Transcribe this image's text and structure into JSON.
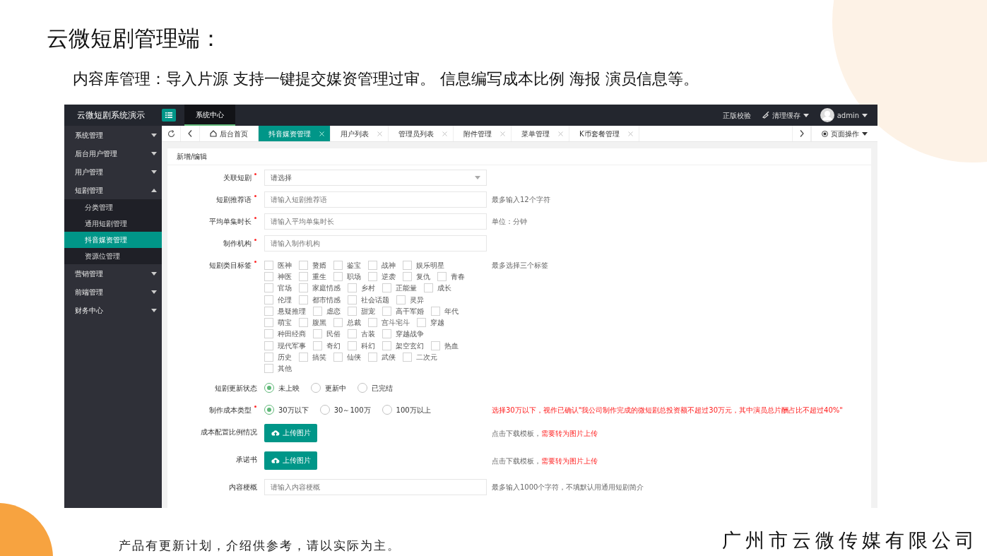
{
  "slide": {
    "title": "云微短剧管理端：",
    "subtitle": "内容库管理：导入片源 支持一键提交媒资管理过审。 信息编写成本比例 海报 演员信息等。",
    "footer_note": "产品有更新计划，介绍供参考，请以实际为主。",
    "company": "广州市云微传媒有限公司"
  },
  "app": {
    "brand": "云微短剧系统演示",
    "top_tabs": [
      {
        "label": "系统中心",
        "selected": true
      }
    ],
    "verify": "正版校验",
    "clear_cache": "清理缓存",
    "user": "admin"
  },
  "sidebar": [
    {
      "label": "系统管理",
      "expanded": false
    },
    {
      "label": "后台用户管理",
      "expanded": false
    },
    {
      "label": "用户管理",
      "expanded": false
    },
    {
      "label": "短剧管理",
      "expanded": true,
      "children": [
        {
          "label": "分类管理",
          "selected": false
        },
        {
          "label": "通用短剧管理",
          "selected": false
        },
        {
          "label": "抖音媒资管理",
          "selected": true
        },
        {
          "label": "资源位管理",
          "selected": false
        }
      ]
    },
    {
      "label": "营销管理",
      "expanded": false
    },
    {
      "label": "前端管理",
      "expanded": false
    },
    {
      "label": "财务中心",
      "expanded": false
    }
  ],
  "tabs": [
    {
      "kind": "home",
      "label": "后台首页",
      "selected": false
    },
    {
      "kind": "page",
      "label": "抖音媒资管理",
      "selected": true
    },
    {
      "kind": "page",
      "label": "用户列表",
      "selected": false
    },
    {
      "kind": "page",
      "label": "管理员列表",
      "selected": false
    },
    {
      "kind": "page",
      "label": "附件管理",
      "selected": false
    },
    {
      "kind": "page",
      "label": "菜单管理",
      "selected": false
    },
    {
      "kind": "page",
      "label": "K币套餐管理",
      "selected": false
    }
  ],
  "page_ops": "页面操作",
  "panel_title": "新增/编辑",
  "form": [
    {
      "kind": "select",
      "label": "关联短剧",
      "required": true,
      "placeholder": "请选择"
    },
    {
      "kind": "input",
      "label": "短剧推荐语",
      "required": true,
      "placeholder": "请输入短剧推荐语",
      "hint": "最多输入12个字符"
    },
    {
      "kind": "input",
      "label": "平均单集时长",
      "required": true,
      "placeholder": "请输入平均单集时长",
      "hint": "单位：分钟"
    },
    {
      "kind": "input",
      "label": "制作机构",
      "required": true,
      "placeholder": "请输入制作机构"
    },
    {
      "kind": "tags",
      "label": "短剧类目标签",
      "required": true,
      "hint": "最多选择三个标签",
      "rows": [
        [
          {
            "label": "医神",
            "checked": false
          },
          {
            "label": "赘婿",
            "checked": false
          },
          {
            "label": "鉴宝",
            "checked": false
          },
          {
            "label": "战神",
            "checked": false
          },
          {
            "label": "娱乐明星",
            "checked": false
          }
        ],
        [
          {
            "label": "神医",
            "checked": false
          },
          {
            "label": "重生",
            "checked": false
          },
          {
            "label": "职场",
            "checked": false
          },
          {
            "label": "逆袭",
            "checked": false
          },
          {
            "label": "复仇",
            "checked": false
          },
          {
            "label": "青春",
            "checked": false
          }
        ],
        [
          {
            "label": "官场",
            "checked": false
          },
          {
            "label": "家庭情感",
            "checked": false
          },
          {
            "label": "乡村",
            "checked": false
          },
          {
            "label": "正能量",
            "checked": false
          },
          {
            "label": "成长",
            "checked": false
          }
        ],
        [
          {
            "label": "伦理",
            "checked": false
          },
          {
            "label": "都市情感",
            "checked": false
          },
          {
            "label": "社会话题",
            "checked": false
          },
          {
            "label": "灵异",
            "checked": false
          }
        ],
        [
          {
            "label": "悬疑推理",
            "checked": false
          },
          {
            "label": "虐恋",
            "checked": false
          },
          {
            "label": "甜宠",
            "checked": false
          },
          {
            "label": "高干军婚",
            "checked": false
          },
          {
            "label": "年代",
            "checked": false
          }
        ],
        [
          {
            "label": "萌宝",
            "checked": false
          },
          {
            "label": "腹黑",
            "checked": false
          },
          {
            "label": "总裁",
            "checked": false
          },
          {
            "label": "宫斗宅斗",
            "checked": false
          },
          {
            "label": "穿越",
            "checked": false
          }
        ],
        [
          {
            "label": "种田经商",
            "checked": false
          },
          {
            "label": "民俗",
            "checked": false
          },
          {
            "label": "古装",
            "checked": false
          },
          {
            "label": "穿越战争",
            "checked": false
          }
        ],
        [
          {
            "label": "现代军事",
            "checked": false
          },
          {
            "label": "奇幻",
            "checked": false
          },
          {
            "label": "科幻",
            "checked": false
          },
          {
            "label": "架空玄幻",
            "checked": false
          },
          {
            "label": "热血",
            "checked": false
          }
        ],
        [
          {
            "label": "历史",
            "checked": false
          },
          {
            "label": "搞笑",
            "checked": false
          },
          {
            "label": "仙侠",
            "checked": false
          },
          {
            "label": "武侠",
            "checked": false
          },
          {
            "label": "二次元",
            "checked": false
          }
        ],
        [
          {
            "label": "其他",
            "checked": false
          }
        ]
      ]
    },
    {
      "kind": "radio",
      "label": "短剧更新状态",
      "required": false,
      "options": [
        {
          "label": "未上映",
          "selected": true
        },
        {
          "label": "更新中",
          "selected": false
        },
        {
          "label": "已完结",
          "selected": false
        }
      ]
    },
    {
      "kind": "radio",
      "label": "制作成本类型",
      "required": true,
      "options": [
        {
          "label": "30万以下",
          "selected": true
        },
        {
          "label": "30～100万",
          "selected": false
        },
        {
          "label": "100万以上",
          "selected": false
        }
      ],
      "alert": "选择30万以下，视作已确认\"我公司制作完成的微短剧总投资额不超过30万元，其中演员总片酬占比不超过40%\""
    },
    {
      "kind": "upload",
      "label": "成本配置比例情况",
      "required": false,
      "button": "上传图片",
      "hint": "点击下载模板，",
      "alert": "需要转为图片上传"
    },
    {
      "kind": "upload",
      "label": "承诺书",
      "required": false,
      "button": "上传图片",
      "hint": "点击下载模板，",
      "alert": "需要转为图片上传"
    },
    {
      "kind": "input",
      "label": "内容梗概",
      "required": false,
      "placeholder": "请输入内容梗概",
      "hint": "最多输入1000个字符，不填默认用通用短剧简介"
    }
  ]
}
